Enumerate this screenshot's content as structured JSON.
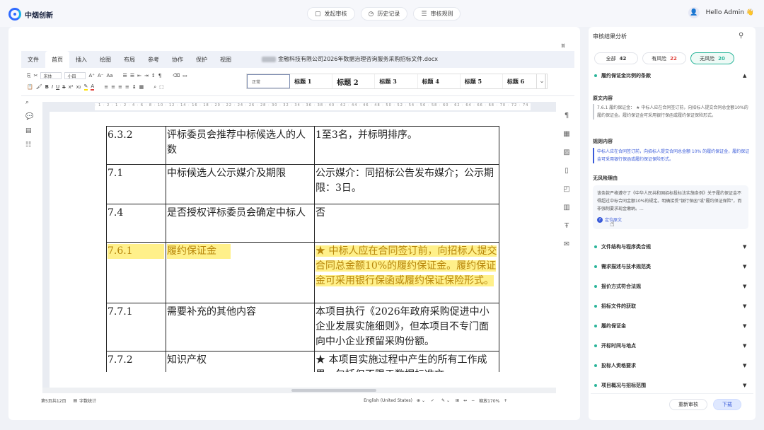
{
  "brand": {
    "name": "中烟创新"
  },
  "topnav": [
    {
      "icon": "new-audit-icon",
      "label": "发起审核"
    },
    {
      "icon": "history-icon",
      "label": "历史记录"
    },
    {
      "icon": "rules-icon",
      "label": "审核规则"
    }
  ],
  "user": {
    "greeting": "Hello Admin 👋"
  },
  "editor": {
    "page_indicator": "首",
    "menu": [
      "文件",
      "首页",
      "插入",
      "绘图",
      "布局",
      "参考",
      "协作",
      "保护",
      "视图"
    ],
    "active_menu": "首页",
    "doc_title": "金融科技有限公司2026年数据治理咨询服务采购招标文件.docx",
    "font_name": "宋体",
    "font_size": "小四",
    "styles": [
      "正常",
      "标题 1",
      "标题 2",
      "标题 3",
      "标题 4",
      "标题 5",
      "标题 6"
    ],
    "ruler_marks": "· 1 · 2 · 1 · 2 · 4 · 6 · 8 · 10 · 12 · 14 · 16 · 18 · 20 · 22 · 24 · 26 · 28 · 30 · 32 · 34 · 36 · 38 · 40 · 42 · 44 · 46 · 48 · 50 · 52 · 54 · 56 · 58 · 60 · 62 · 64 · 66 · 68 · 70 · 72 · 74 · 76 · 78 · 80 · 82 · 84 · 86 · 88 · 90",
    "table_rows": [
      {
        "num": "6.3.2",
        "item": "评标委员会推荐中标候选人的人数",
        "content": "1至3名，并标明排序。",
        "highlight": false
      },
      {
        "num": "7.1",
        "item": "中标候选人公示媒介及期限",
        "content": "公示媒介：同招标公告发布媒介；公示期限：3日。",
        "highlight": false
      },
      {
        "num": "7.4",
        "item": "是否授权评标委员会确定中标人",
        "content": "否",
        "highlight": false
      },
      {
        "num": "7.6.1",
        "item": "履约保证金",
        "content": "★ 中标人应在合同签订前，向招标人提交合同总金额10%的履约保证金。履约保证金可采用银行保函或履约保证保险形式。",
        "highlight": true
      },
      {
        "num": "7.7.1",
        "item": "需要补充的其他内容",
        "content": "本项目执行《2026年政府采购促进中小企业发展实施细则》，但本项目不专门面向中小企业预留采购份额。",
        "highlight": false
      },
      {
        "num": "7.7.2",
        "item": "知识产权",
        "content": "★ 本项目实施过程中产生的所有工作成果，包括但不限于数据标准文",
        "highlight": false
      }
    ],
    "status": {
      "page": "第5页共12页",
      "word_count": "字数统计",
      "language": "English (United States)",
      "zoom": "缩放170%"
    }
  },
  "review": {
    "title": "审核结果分析",
    "filters": [
      {
        "label": "全部",
        "count": "42",
        "color": "#333333"
      },
      {
        "label": "有风险",
        "count": "22",
        "color": "#e0403a"
      },
      {
        "label": "无风险",
        "count": "20",
        "color": "#2bb59a"
      }
    ],
    "active_filter": "无风险",
    "expanded": {
      "title": "履约保证金比例的条款",
      "original_label": "原文内容",
      "original_text": "7.6.1 履约保证金： ★ 中标人应在合同签订前，向招标人提交合同总金额10%的履约保证金。履约保证金可采用银行保函或履约保证保险形式。",
      "rule_label": "规则内容",
      "rule_text": "中标人应在合同签订前，向招标人提交合同总金额 10% 的履约保证金，履约保证金可采用银行保函或履约保证保险形式。",
      "reason_label": "无风险理由",
      "reason_text": "该条款严格遵守了《中华人民共和国招标投标法实施条例》关于履约保证金不得超过中标合同金额10%的规定。明确接受\"银行保函\"或\"履约保证保险\"，而非强制要求现金缴纳。...",
      "locate_label": "定位原文"
    },
    "sections": [
      "文件结构与程序类合规",
      "需求描述与技术规范类",
      "报价方式符合法规",
      "招标文件的获取",
      "履约保证金",
      "开标时间与地点",
      "投标人资格要求",
      "项目概况与招标范围"
    ],
    "buttons": {
      "recheck": "重新审核",
      "download": "下载"
    }
  }
}
